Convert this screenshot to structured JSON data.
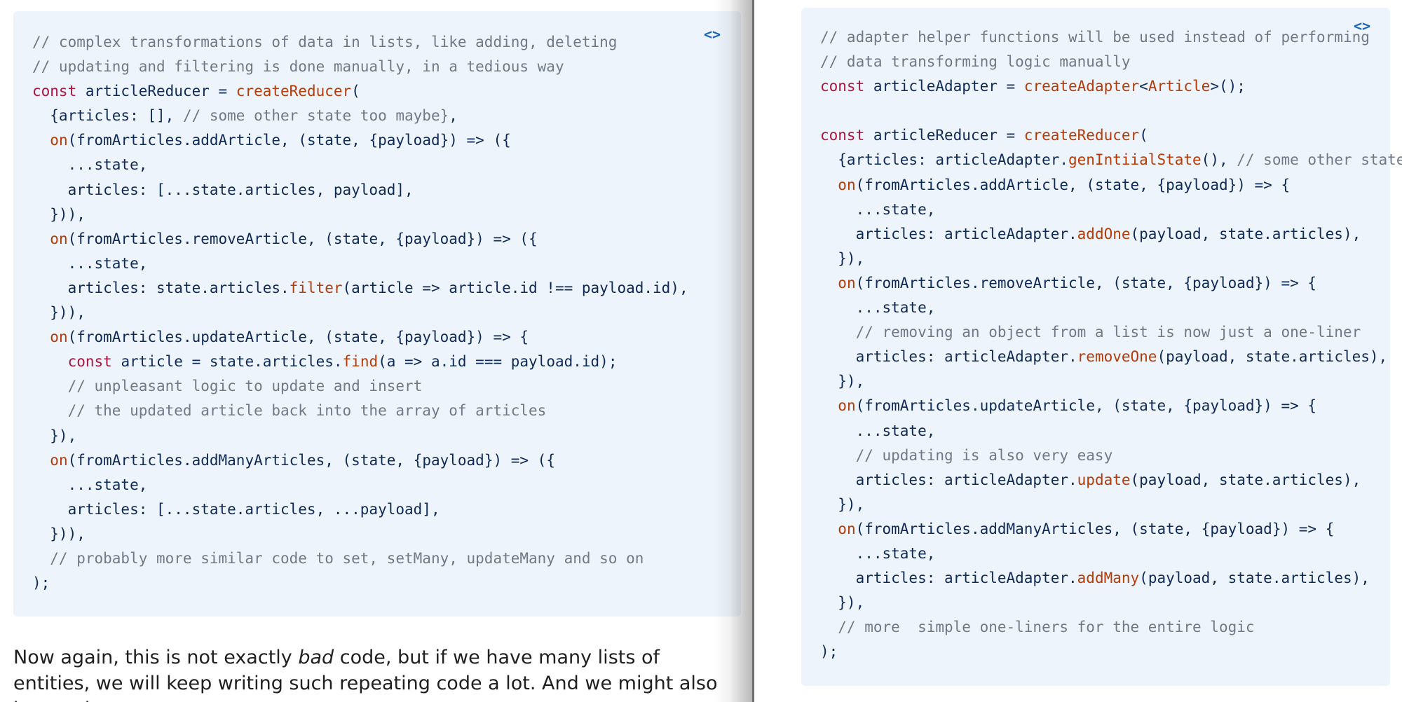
{
  "left_pane": {
    "code_icon": "<>",
    "code_lines": [
      [
        {
          "c": "// complex transformations of data in lists, like adding, deleting",
          "t": "cm"
        }
      ],
      [
        {
          "c": "// updating and filtering is done manually, in a tedious way",
          "t": "cm"
        }
      ],
      [
        {
          "c": "const",
          "t": "kw"
        },
        {
          "c": " articleReducer = "
        },
        {
          "c": "createReducer",
          "t": "fn"
        },
        {
          "c": "("
        }
      ],
      [
        {
          "c": "  {articles: [], "
        },
        {
          "c": "// some other state too maybe}",
          "t": "cm"
        },
        {
          "c": ","
        }
      ],
      [
        {
          "c": "  "
        },
        {
          "c": "on",
          "t": "fn"
        },
        {
          "c": "(fromArticles.addArticle, (state, {payload}) => ({"
        }
      ],
      [
        {
          "c": "    ...state,"
        }
      ],
      [
        {
          "c": "    articles: [...state.articles, payload],"
        }
      ],
      [
        {
          "c": "  })),"
        }
      ],
      [
        {
          "c": "  "
        },
        {
          "c": "on",
          "t": "fn"
        },
        {
          "c": "(fromArticles.removeArticle, (state, {payload}) => ({"
        }
      ],
      [
        {
          "c": "    ...state,"
        }
      ],
      [
        {
          "c": "    articles: state.articles."
        },
        {
          "c": "filter",
          "t": "fn"
        },
        {
          "c": "(article => article.id !== payload.id),"
        }
      ],
      [
        {
          "c": "  })),"
        }
      ],
      [
        {
          "c": "  "
        },
        {
          "c": "on",
          "t": "fn"
        },
        {
          "c": "(fromArticles.updateArticle, (state, {payload}) => {"
        }
      ],
      [
        {
          "c": "    "
        },
        {
          "c": "const",
          "t": "kw"
        },
        {
          "c": " article = state.articles."
        },
        {
          "c": "find",
          "t": "fn"
        },
        {
          "c": "(a => a.id === payload.id);"
        }
      ],
      [
        {
          "c": "    // unpleasant logic to update and insert",
          "t": "cm"
        }
      ],
      [
        {
          "c": "    // the updated article back into the array of articles",
          "t": "cm"
        }
      ],
      [
        {
          "c": "  }),"
        }
      ],
      [
        {
          "c": "  "
        },
        {
          "c": "on",
          "t": "fn"
        },
        {
          "c": "(fromArticles.addManyArticles, (state, {payload}) => ({"
        }
      ],
      [
        {
          "c": "    ...state,"
        }
      ],
      [
        {
          "c": "    articles: [...state.articles, ...payload],"
        }
      ],
      [
        {
          "c": "  })),"
        }
      ],
      [
        {
          "c": "  // probably more similar code to set, setMany, updateMany and so on",
          "t": "cm"
        }
      ],
      [
        {
          "c": ");"
        }
      ]
    ],
    "prose": {
      "before_em": "Now again, this is not exactly ",
      "em": "bad",
      "after_em": " code, but if we have many lists of entities, we will keep writing such repeating code a lot. And we might also have other"
    }
  },
  "right_pane": {
    "code_icon": "<>",
    "code_lines": [
      [
        {
          "c": "// adapter helper functions will be used instead of performing",
          "t": "cm"
        }
      ],
      [
        {
          "c": "// data transforming logic manually",
          "t": "cm"
        }
      ],
      [
        {
          "c": "const",
          "t": "kw"
        },
        {
          "c": " articleAdapter = "
        },
        {
          "c": "createAdapter",
          "t": "fn"
        },
        {
          "c": "<"
        },
        {
          "c": "Article",
          "t": "fn"
        },
        {
          "c": ">();"
        }
      ],
      [
        {
          "c": ""
        }
      ],
      [
        {
          "c": "const",
          "t": "kw"
        },
        {
          "c": " articleReducer = "
        },
        {
          "c": "createReducer",
          "t": "fn"
        },
        {
          "c": "("
        }
      ],
      [
        {
          "c": "  {articles: articleAdapter."
        },
        {
          "c": "genIntiialState",
          "t": "fn"
        },
        {
          "c": "(), "
        },
        {
          "c": "// some other state too",
          "t": "cm"
        }
      ],
      [
        {
          "c": "  "
        },
        {
          "c": "on",
          "t": "fn"
        },
        {
          "c": "(fromArticles.addArticle, (state, {payload}) => {"
        }
      ],
      [
        {
          "c": "    ...state,"
        }
      ],
      [
        {
          "c": "    articles: articleAdapter."
        },
        {
          "c": "addOne",
          "t": "fn"
        },
        {
          "c": "(payload, state.articles),"
        }
      ],
      [
        {
          "c": "  }),"
        }
      ],
      [
        {
          "c": "  "
        },
        {
          "c": "on",
          "t": "fn"
        },
        {
          "c": "(fromArticles.removeArticle, (state, {payload}) => {"
        }
      ],
      [
        {
          "c": "    ...state,"
        }
      ],
      [
        {
          "c": "    // removing an object from a list is now just a one-liner",
          "t": "cm"
        }
      ],
      [
        {
          "c": "    articles: articleAdapter."
        },
        {
          "c": "removeOne",
          "t": "fn"
        },
        {
          "c": "(payload, state.articles),"
        }
      ],
      [
        {
          "c": "  }),"
        }
      ],
      [
        {
          "c": "  "
        },
        {
          "c": "on",
          "t": "fn"
        },
        {
          "c": "(fromArticles.updateArticle, (state, {payload}) => {"
        }
      ],
      [
        {
          "c": "    ...state,"
        }
      ],
      [
        {
          "c": "    // updating is also very easy",
          "t": "cm"
        }
      ],
      [
        {
          "c": "    articles: articleAdapter."
        },
        {
          "c": "update",
          "t": "fn"
        },
        {
          "c": "(payload, state.articles),"
        }
      ],
      [
        {
          "c": "  }),"
        }
      ],
      [
        {
          "c": "  "
        },
        {
          "c": "on",
          "t": "fn"
        },
        {
          "c": "(fromArticles.addManyArticles, (state, {payload}) => {"
        }
      ],
      [
        {
          "c": "    ...state,"
        }
      ],
      [
        {
          "c": "    articles: articleAdapter."
        },
        {
          "c": "addMany",
          "t": "fn"
        },
        {
          "c": "(payload, state.articles),"
        }
      ],
      [
        {
          "c": "  }),"
        }
      ],
      [
        {
          "c": "  // more  simple one-liners for the entire logic",
          "t": "cm"
        }
      ],
      [
        {
          "c": ");"
        }
      ]
    ]
  },
  "colors": {
    "code_background": "#edf4fc",
    "comment": "#707987",
    "keyword": "#b0133b",
    "function": "#b63b07",
    "plain": "#0f2a56",
    "icon": "#1f66b5"
  }
}
